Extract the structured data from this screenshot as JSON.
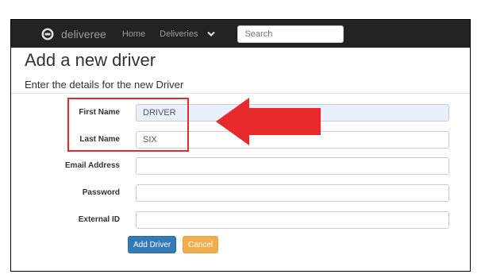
{
  "app": {
    "brand": "deliveree"
  },
  "nav": {
    "home": "Home",
    "deliveries": "Deliveries"
  },
  "search": {
    "placeholder": "Search"
  },
  "page": {
    "title": "Add a new driver",
    "subtitle": "Enter the details for the new Driver"
  },
  "form": {
    "first_name": {
      "label": "First Name",
      "value": "DRIVER"
    },
    "last_name": {
      "label": "Last Name",
      "value": "SIX"
    },
    "email": {
      "label": "Email Address",
      "value": ""
    },
    "password": {
      "label": "Password",
      "value": ""
    },
    "external_id": {
      "label": "External ID",
      "value": ""
    }
  },
  "buttons": {
    "add": "Add Driver",
    "cancel": "Cancel"
  },
  "colors": {
    "navbar": "#222222",
    "primary": "#337ab7",
    "warning": "#f0ad4e",
    "annotation": "#e8292c",
    "autofill": "#e8f0fe"
  },
  "icons": {
    "brand": "brand-logo-icon",
    "dropdown": "chevron-down-icon"
  }
}
